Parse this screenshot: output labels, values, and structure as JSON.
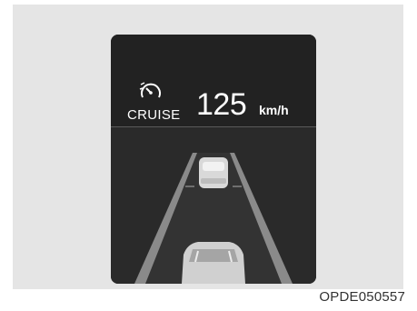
{
  "cluster": {
    "mode_label": "CRUISE",
    "set_speed": "125",
    "speed_unit": "km/h",
    "icon": "cruise-control-speedometer-icon"
  },
  "figure": {
    "caption": "OPDE050557"
  },
  "colors": {
    "screen_background": "#262626",
    "panel_background": "#e5e5e5",
    "text": "#ffffff"
  }
}
